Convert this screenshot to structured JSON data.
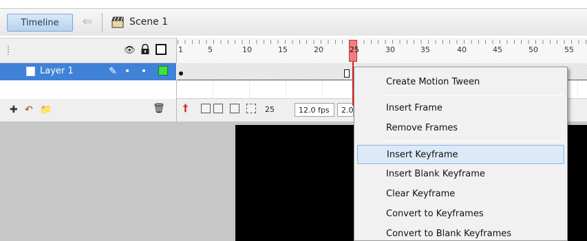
{
  "toolbar": {
    "timeline_label": "Timeline",
    "scene_label": "Scene 1",
    "back_icon": "back-arrow-icon",
    "scene_icon": "clapperboard-icon"
  },
  "layers_header": {
    "eye_icon": "eye-icon",
    "lock_icon": "lock-icon",
    "outline_icon": "outline-square-icon"
  },
  "ruler": {
    "frame_numbers": [
      "1",
      "5",
      "10",
      "15",
      "20",
      "25",
      "30",
      "35",
      "40",
      "45",
      "50",
      "55"
    ],
    "current_frame": "25"
  },
  "layer": {
    "name": "Layer 1",
    "outline_color": "#41e041",
    "selection_color": "#3f82d8"
  },
  "bottom_bar": {
    "current_frame": "25",
    "frame_rate": "12.0 fps",
    "elapsed_time": "2.0"
  },
  "playhead_color": "#d42020",
  "context_menu": {
    "items": [
      "Create Motion Tween",
      "Insert Frame",
      "Remove Frames",
      "Insert Keyframe",
      "Insert Blank Keyframe",
      "Clear Keyframe",
      "Convert to Keyframes",
      "Convert to Blank Keyframes"
    ],
    "highlighted": "Insert Keyframe"
  }
}
